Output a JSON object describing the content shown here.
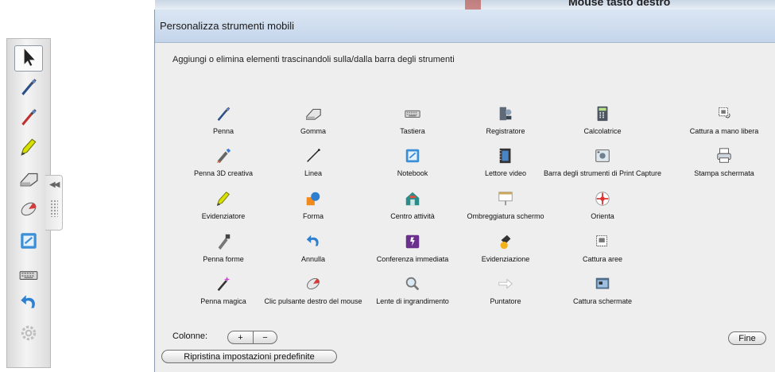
{
  "background": {
    "partial_text": "Mouse tasto destro"
  },
  "toolbar": {
    "buttons": [
      {
        "name": "select-arrow-icon",
        "selected": true
      },
      {
        "name": "pen-icon"
      },
      {
        "name": "pen-red-icon"
      },
      {
        "name": "highlighter-icon"
      },
      {
        "name": "eraser-icon"
      },
      {
        "name": "right-click-mouse-icon"
      },
      {
        "name": "notebook-icon"
      },
      {
        "name": "keyboard-icon"
      },
      {
        "name": "undo-icon"
      },
      {
        "name": "settings-gear-icon"
      }
    ],
    "handle_arrows": "◀◀"
  },
  "dialog": {
    "title": "Personalizza strumenti mobili",
    "instructions": "Aggiungi o elimina elementi trascinandoli sulla/dalla barra degli strumenti",
    "columns_label": "Colonne:",
    "plus_label": "+",
    "minus_label": "−",
    "reset_label": "Ripristina impostazioni predefinite",
    "done_label": "Fine"
  },
  "tools": [
    [
      {
        "label": "Penna",
        "icon": "pen-icon"
      },
      {
        "label": "Gomma",
        "icon": "eraser-icon"
      },
      {
        "label": "Tastiera",
        "icon": "keyboard-icon"
      },
      {
        "label": "Registratore",
        "icon": "recorder-icon"
      },
      {
        "label": "Calcolatrice",
        "icon": "calculator-icon"
      },
      {
        "label": "Cattura a mano libera",
        "icon": "freehand-capture-icon"
      }
    ],
    [
      {
        "label": "Penna 3D creativa",
        "icon": "creative-pen-icon"
      },
      {
        "label": "Linea",
        "icon": "line-icon"
      },
      {
        "label": "Notebook",
        "icon": "notebook-icon"
      },
      {
        "label": "Lettore video",
        "icon": "video-player-icon"
      },
      {
        "label": "Barra degli strumenti di Print Capture",
        "icon": "print-capture-toolbar-icon"
      },
      {
        "label": "Stampa schermata",
        "icon": "print-screen-icon"
      }
    ],
    [
      {
        "label": "Evidenziatore",
        "icon": "highlighter-icon"
      },
      {
        "label": "Forma",
        "icon": "shape-icon"
      },
      {
        "label": "Centro attività",
        "icon": "activity-center-icon"
      },
      {
        "label": "Ombreggiatura schermo",
        "icon": "screen-shade-icon"
      },
      {
        "label": "Orienta",
        "icon": "orient-icon"
      }
    ],
    [
      {
        "label": "Penna forme",
        "icon": "shape-pen-icon"
      },
      {
        "label": "Annulla",
        "icon": "undo-icon"
      },
      {
        "label": "Conferenza immediata",
        "icon": "instant-conference-icon"
      },
      {
        "label": "Evidenziazione",
        "icon": "spotlight-icon"
      },
      {
        "label": "Cattura aree",
        "icon": "area-capture-icon"
      }
    ],
    [
      {
        "label": "Penna magica",
        "icon": "magic-pen-icon"
      },
      {
        "label": "Clic pulsante destro del mouse",
        "icon": "right-click-mouse-icon"
      },
      {
        "label": "Lente di ingrandimento",
        "icon": "magnifier-icon"
      },
      {
        "label": "Puntatore",
        "icon": "pointer-icon"
      },
      {
        "label": "Cattura schermate",
        "icon": "screen-capture-icon"
      }
    ]
  ],
  "colors": {
    "titlebar": "#c9d9ec",
    "dialog_bg": "#eeeeee",
    "highlighter": "#d8e000",
    "notebook_blue": "#3b8fd6",
    "undo_blue": "#2f7fd0"
  }
}
